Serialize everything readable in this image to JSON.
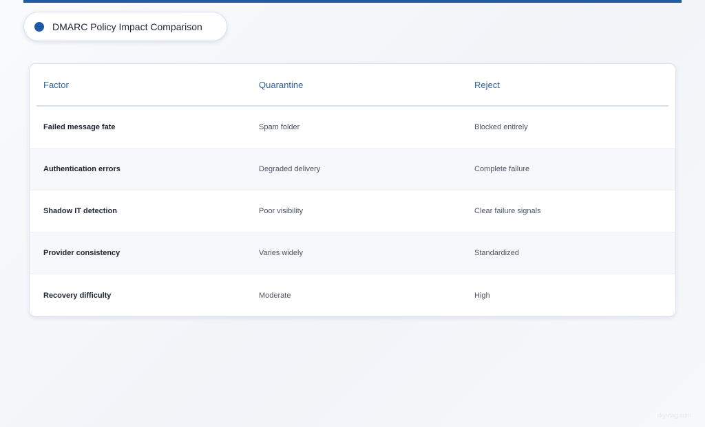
{
  "title": {
    "text": "DMARC Policy Impact Comparison"
  },
  "colors": {
    "accent": "#1f5aa6",
    "header_text": "#2a62a8"
  },
  "table": {
    "headers": [
      "Factor",
      "Quarantine",
      "Reject"
    ],
    "rows": [
      {
        "factor": "Failed message fate",
        "quarantine": "Spam folder",
        "reject": "Blocked entirely"
      },
      {
        "factor": "Authentication errors",
        "quarantine": "Degraded delivery",
        "reject": "Complete failure"
      },
      {
        "factor": "Shadow IT detection",
        "quarantine": "Poor visibility",
        "reject": "Clear failure signals"
      },
      {
        "factor": "Provider consistency",
        "quarantine": "Varies widely",
        "reject": "Standardized"
      },
      {
        "factor": "Recovery difficulty",
        "quarantine": "Moderate",
        "reject": "High"
      }
    ]
  },
  "watermark": "skyvtag.com"
}
